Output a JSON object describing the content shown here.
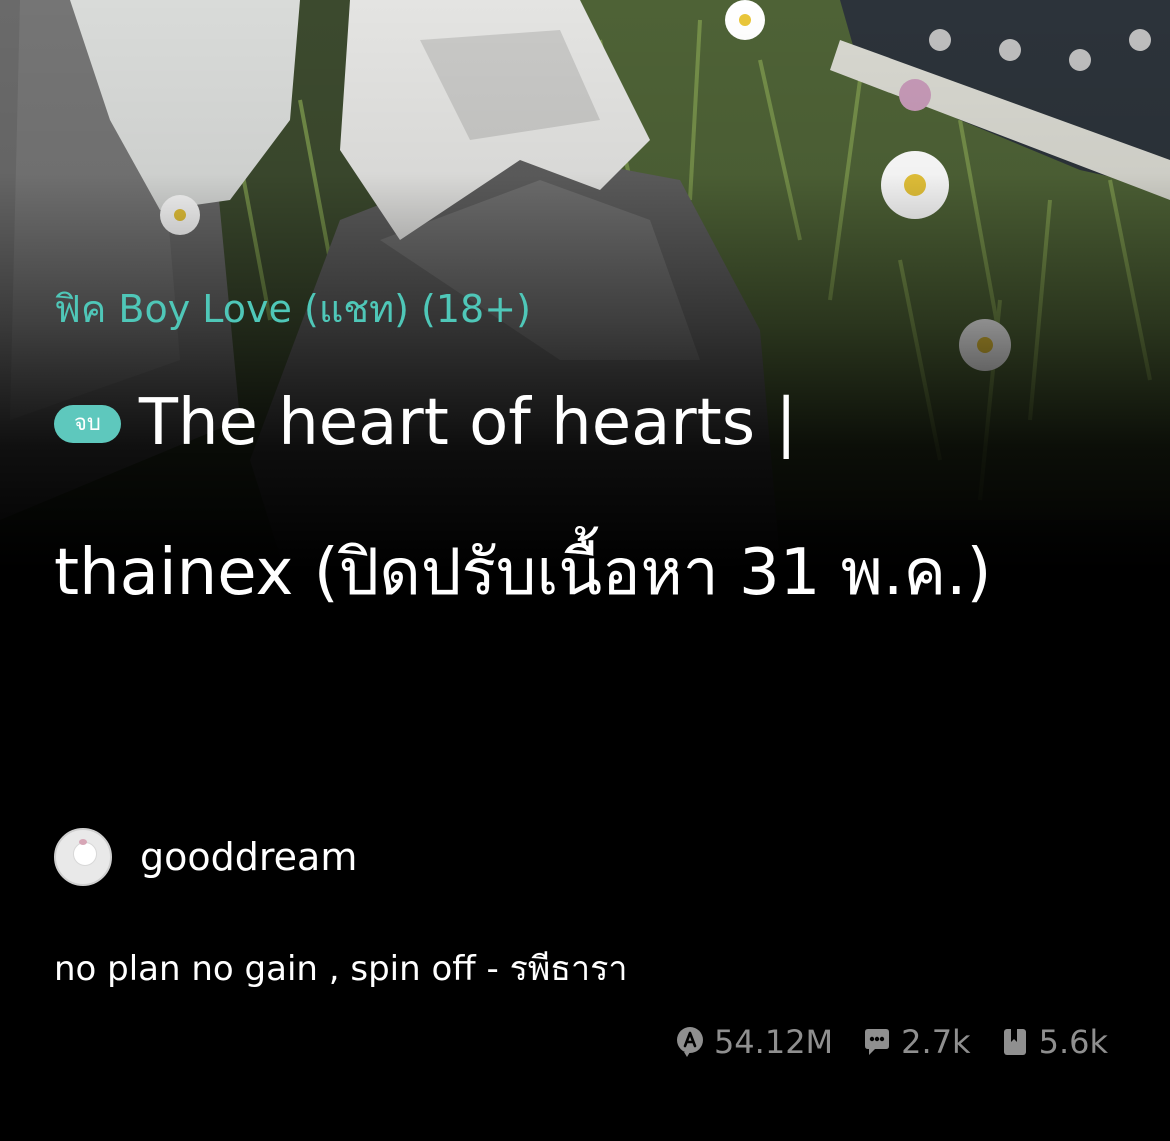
{
  "story": {
    "category": "ฟิค Boy Love (แชท) (18+)",
    "status_badge": "จบ",
    "title": "The heart of hearts | thainex (ปิดปรับเนื้อหา 31 พ.ค.)",
    "author": "gooddream",
    "description": "no plan no gain , spin off - รพีธารา"
  },
  "stats": {
    "views": "54.12M",
    "comments": "2.7k",
    "bookmarks": "5.6k"
  },
  "icons": {
    "views": "eye-badge-icon",
    "comments": "comment-bubble-icon",
    "bookmarks": "bookmark-icon"
  },
  "colors": {
    "accent": "#4fc7b8",
    "badge": "#5ec8bd",
    "background": "#000000",
    "stat_text": "#8f8f8f"
  }
}
